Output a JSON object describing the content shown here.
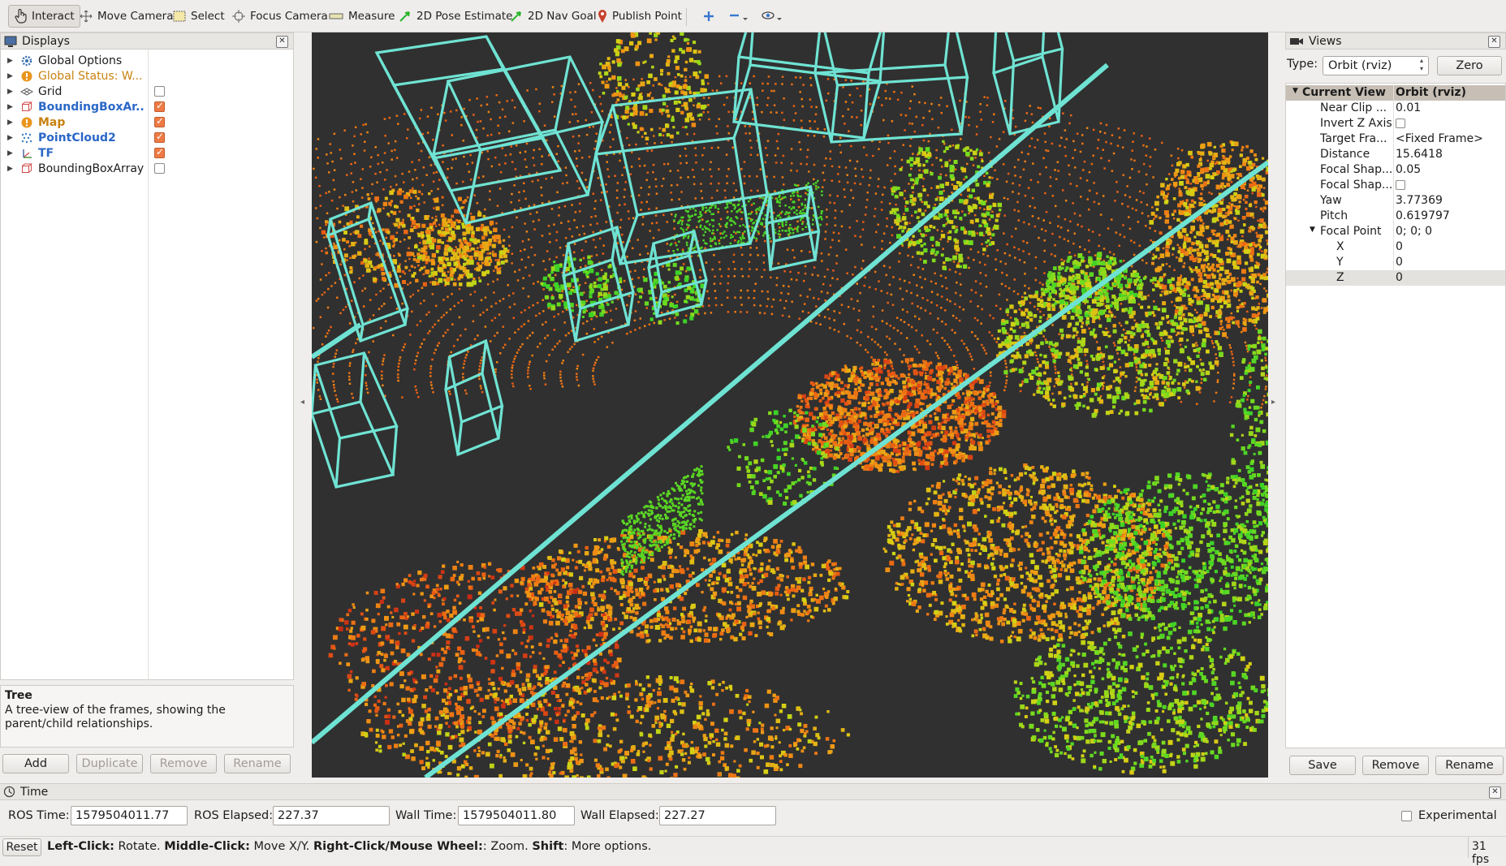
{
  "toolbar": {
    "interact": "Interact",
    "move_camera": "Move Camera",
    "select": "Select",
    "focus_camera": "Focus Camera",
    "measure": "Measure",
    "pose_estimate": "2D Pose Estimate",
    "nav_goal": "2D Nav Goal",
    "publish_point": "Publish Point"
  },
  "displays": {
    "title": "Displays",
    "items": [
      {
        "label": "Global Options",
        "icon": "gear-icon",
        "color": "#1c1c1c",
        "bold": false,
        "checkbox": null
      },
      {
        "label": "Global Status: W...",
        "icon": "warning-icon",
        "color": "#c88210",
        "bold": false,
        "checkbox": null
      },
      {
        "label": "Grid",
        "icon": "grid-icon",
        "color": "#1c1c1c",
        "bold": false,
        "checkbox": false
      },
      {
        "label": "BoundingBoxAr...",
        "icon": "bounding-box-icon",
        "color": "#2a67c8",
        "bold": true,
        "checkbox": true
      },
      {
        "label": "Map",
        "icon": "warning-icon",
        "color": "#c88210",
        "bold": true,
        "checkbox": true
      },
      {
        "label": "PointCloud2",
        "icon": "pointcloud-icon",
        "color": "#2a67c8",
        "bold": true,
        "checkbox": true
      },
      {
        "label": "TF",
        "icon": "tf-icon",
        "color": "#2a67c8",
        "bold": true,
        "checkbox": true
      },
      {
        "label": "BoundingBoxArray",
        "icon": "bounding-box-icon",
        "color": "#1c1c1c",
        "bold": false,
        "checkbox": false
      }
    ],
    "description_title": "Tree",
    "description_text": "A tree-view of the frames, showing the parent/child relationships.",
    "buttons": {
      "add": "Add",
      "duplicate": "Duplicate",
      "remove": "Remove",
      "rename": "Rename"
    }
  },
  "views": {
    "title": "Views",
    "type_label": "Type:",
    "type_value": "Orbit (rviz)",
    "zero_button": "Zero",
    "rows": [
      {
        "key": "Current View",
        "value": "Orbit (rviz)",
        "indent": 0,
        "header": true
      },
      {
        "key": "Near Clip ...",
        "value": "0.01",
        "indent": 1
      },
      {
        "key": "Invert Z Axis",
        "value": "",
        "indent": 1,
        "checkbox": true
      },
      {
        "key": "Target Fra...",
        "value": "<Fixed Frame>",
        "indent": 1
      },
      {
        "key": "Distance",
        "value": "15.6418",
        "indent": 1
      },
      {
        "key": "Focal Shap...",
        "value": "0.05",
        "indent": 1
      },
      {
        "key": "Focal Shap...",
        "value": "",
        "indent": 1,
        "checkbox": true
      },
      {
        "key": "Yaw",
        "value": "3.77369",
        "indent": 1
      },
      {
        "key": "Pitch",
        "value": "0.619797",
        "indent": 1
      },
      {
        "key": "Focal Point",
        "value": "0; 0; 0",
        "indent": 1,
        "expanded": true
      },
      {
        "key": "X",
        "value": "0",
        "indent": 2
      },
      {
        "key": "Y",
        "value": "0",
        "indent": 2
      },
      {
        "key": "Z",
        "value": "0",
        "indent": 2,
        "selected": true
      }
    ],
    "buttons": {
      "save": "Save",
      "remove": "Remove",
      "rename": "Rename"
    }
  },
  "time": {
    "title": "Time",
    "ros_time_label": "ROS Time:",
    "ros_time": "1579504011.77",
    "ros_elapsed_label": "ROS Elapsed:",
    "ros_elapsed": "227.37",
    "wall_time_label": "Wall Time:",
    "wall_time": "1579504011.80",
    "wall_elapsed_label": "Wall Elapsed:",
    "wall_elapsed": "227.27",
    "experimental_label": "Experimental"
  },
  "status": {
    "reset": "Reset",
    "left_click": "Left-Click:",
    "left_click_desc": " Rotate. ",
    "middle_click": "Middle-Click:",
    "middle_click_desc": " Move X/Y. ",
    "right_click": "Right-Click/Mouse Wheel:",
    "right_click_desc": ": Zoom. ",
    "shift": "Shift",
    "shift_desc": ": More options.",
    "fps": "31 fps"
  },
  "viewport": {
    "background": "#303030",
    "box_color": "#6fe3d3"
  }
}
